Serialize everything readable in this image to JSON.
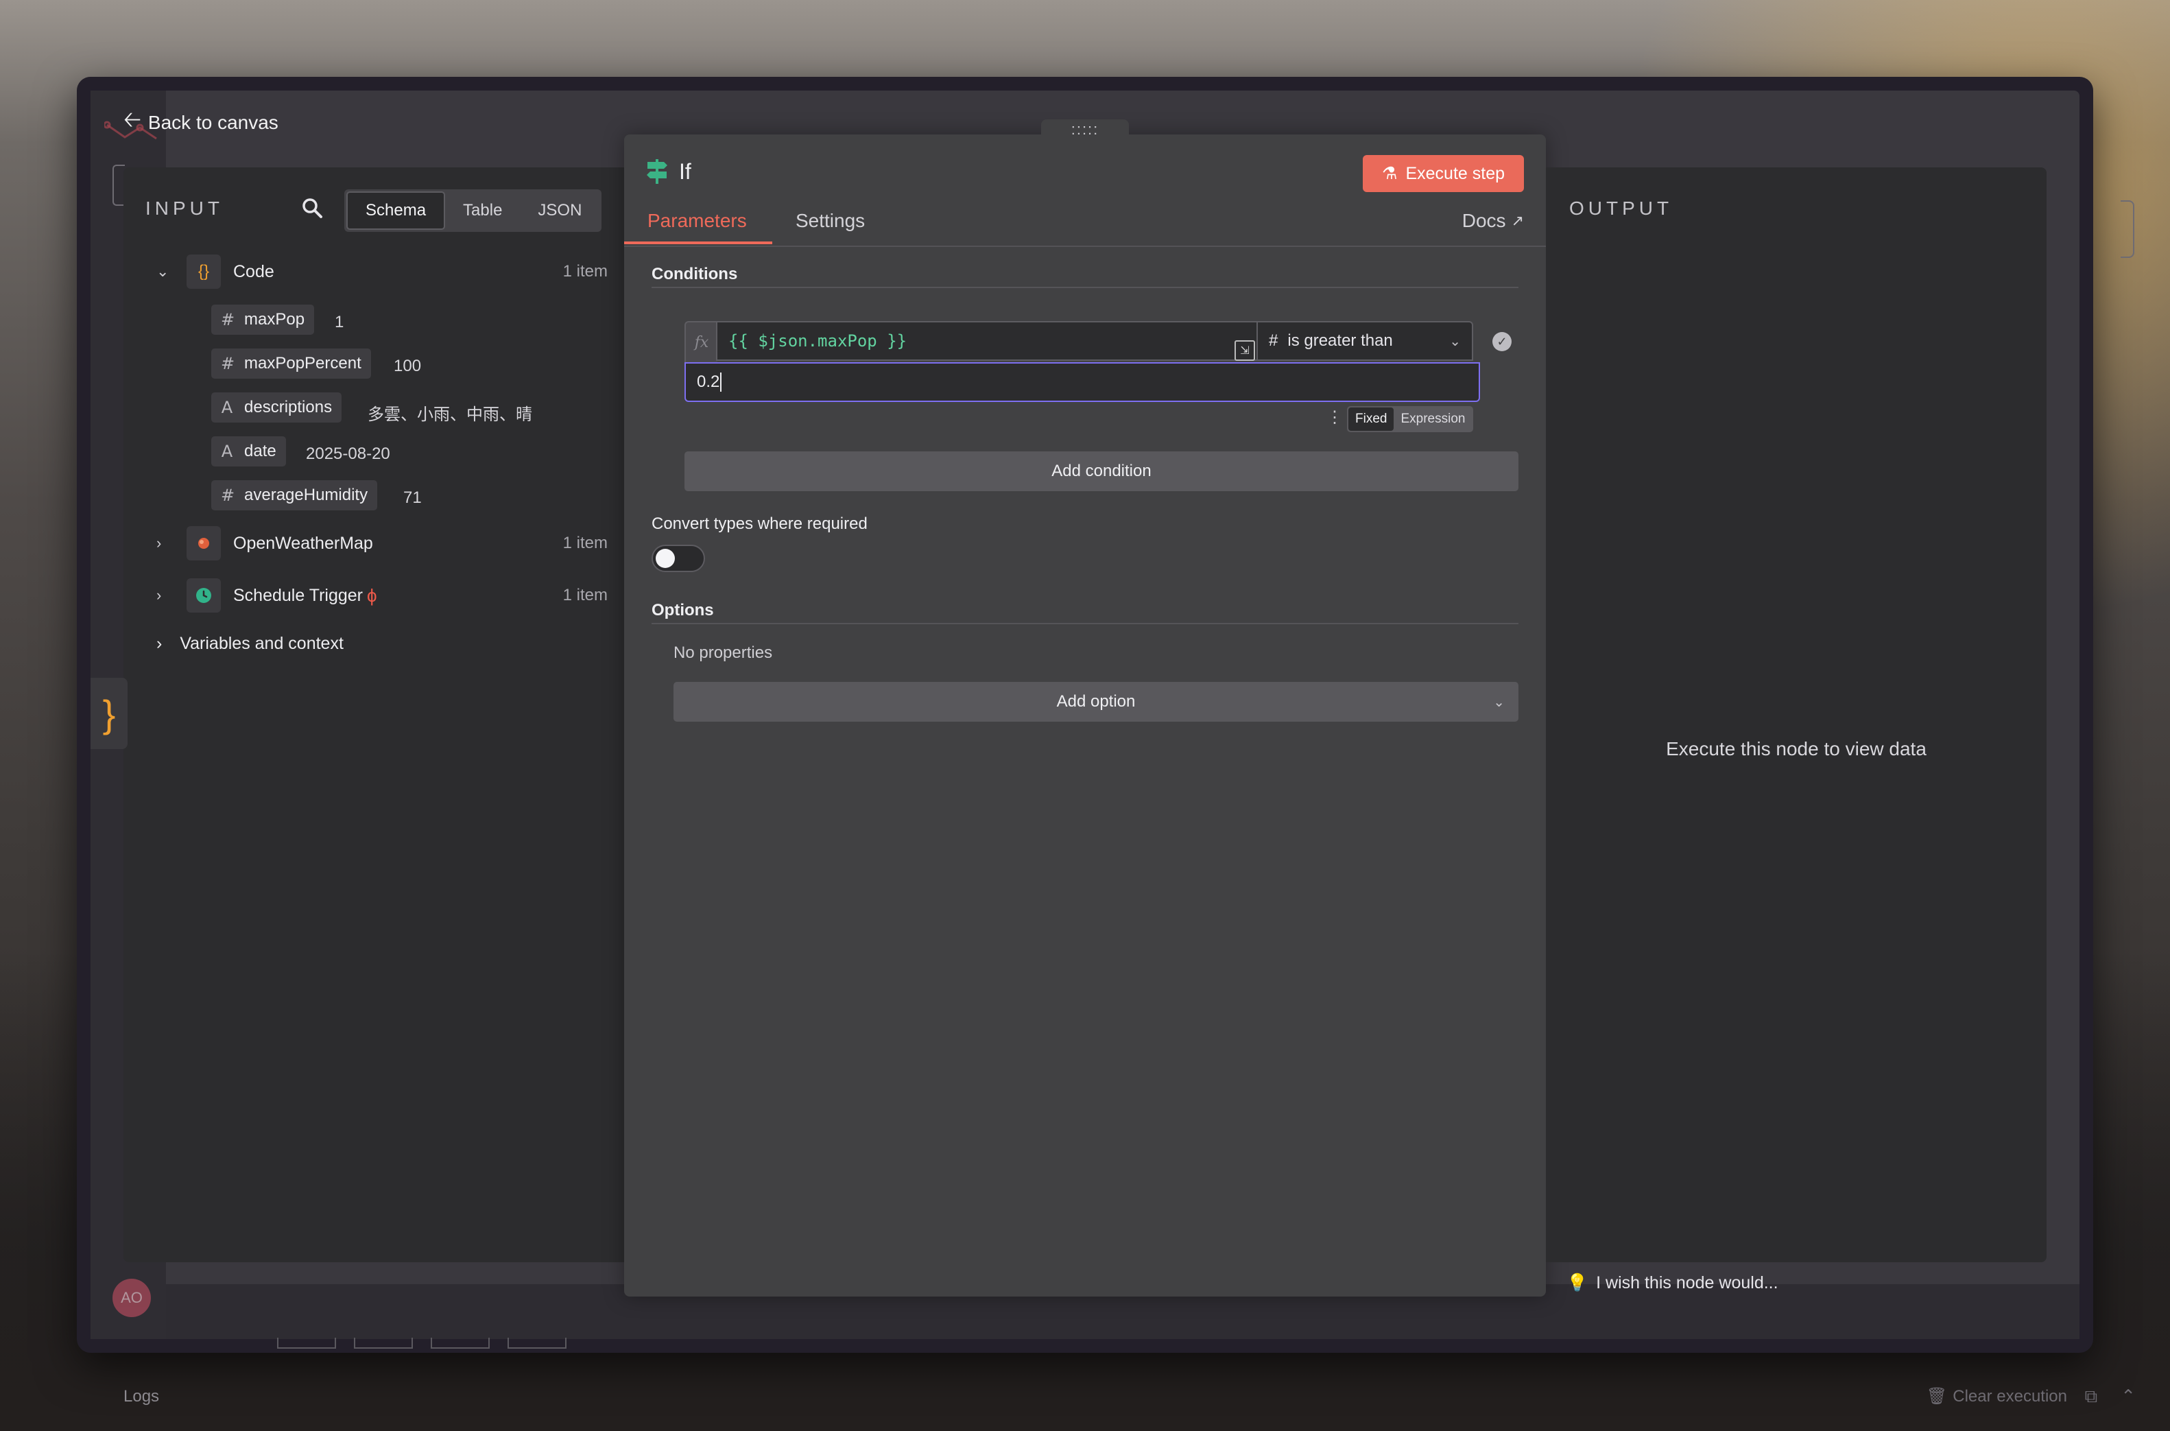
{
  "header": {
    "back_label": "Back to canvas"
  },
  "input_panel": {
    "title": "INPUT",
    "view_tabs": [
      "Schema",
      "Table",
      "JSON"
    ],
    "nodes": [
      {
        "name": "Code",
        "count": "1 item",
        "icon": "code-braces-icon",
        "fields": [
          {
            "type": "#",
            "name": "maxPop",
            "value": "1"
          },
          {
            "type": "#",
            "name": "maxPopPercent",
            "value": "100"
          },
          {
            "type": "A",
            "name": "descriptions",
            "value": "多雲、小雨、中雨、晴"
          },
          {
            "type": "A",
            "name": "date",
            "value": "2025-08-20"
          },
          {
            "type": "#",
            "name": "averageHumidity",
            "value": "71"
          }
        ]
      },
      {
        "name": "OpenWeatherMap",
        "count": "1 item",
        "icon": "weather-icon"
      },
      {
        "name": "Schedule Trigger",
        "count": "1 item",
        "icon": "clock-icon"
      }
    ],
    "variables_label": "Variables and context"
  },
  "node_editor": {
    "title": "If",
    "execute_label": "Execute step",
    "tabs": {
      "parameters": "Parameters",
      "settings": "Settings",
      "docs": "Docs"
    },
    "conditions_title": "Conditions",
    "condition": {
      "fx": "fx",
      "left_value": "{{ $json.maxPop }}",
      "operator_type": "#",
      "operator": "is greater than",
      "right_value": "0.2"
    },
    "mode_toggle": {
      "fixed": "Fixed",
      "expression": "Expression"
    },
    "add_condition_label": "Add condition",
    "convert_label": "Convert types where required",
    "convert_enabled": false,
    "options_title": "Options",
    "no_properties": "No properties",
    "add_option_label": "Add option",
    "drag_handle": ":::::"
  },
  "output_panel": {
    "title": "OUTPUT",
    "empty_message": "Execute this node to view data",
    "wish_label": "I wish this node would..."
  },
  "footer": {
    "logs_label": "Logs",
    "clear_label": "Clear execution",
    "avatar_initials": "AO"
  },
  "colors": {
    "accent": "#ea6a5a",
    "expression_green": "#62d3a0",
    "focus_purple": "#7d6ff0",
    "code_orange": "#f0a030"
  }
}
